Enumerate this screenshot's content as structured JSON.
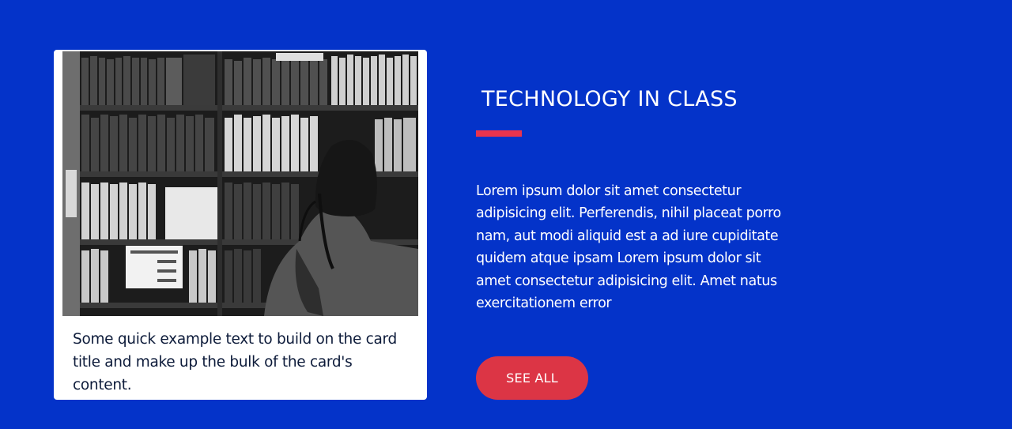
{
  "card": {
    "image_alt": "Person browsing books on library shelves",
    "text": "Some quick example text to build on the card title and make up the bulk of the card's content."
  },
  "feature": {
    "title": "TECHNOLOGY IN CLASS",
    "body": "Lorem ipsum dolor sit amet consectetur adipisicing elit. Perferendis, nihil placeat porro nam, aut modi aliquid est a ad iure cupiditate quidem atque ipsam Lorem ipsum dolor sit amet consectetur adipisicing elit. Amet natus exercitationem error",
    "button_label": "SEE ALL"
  },
  "colors": {
    "background": "#0433c9",
    "accent": "#e8344e",
    "button": "#dc3545",
    "card": "#ffffff"
  }
}
